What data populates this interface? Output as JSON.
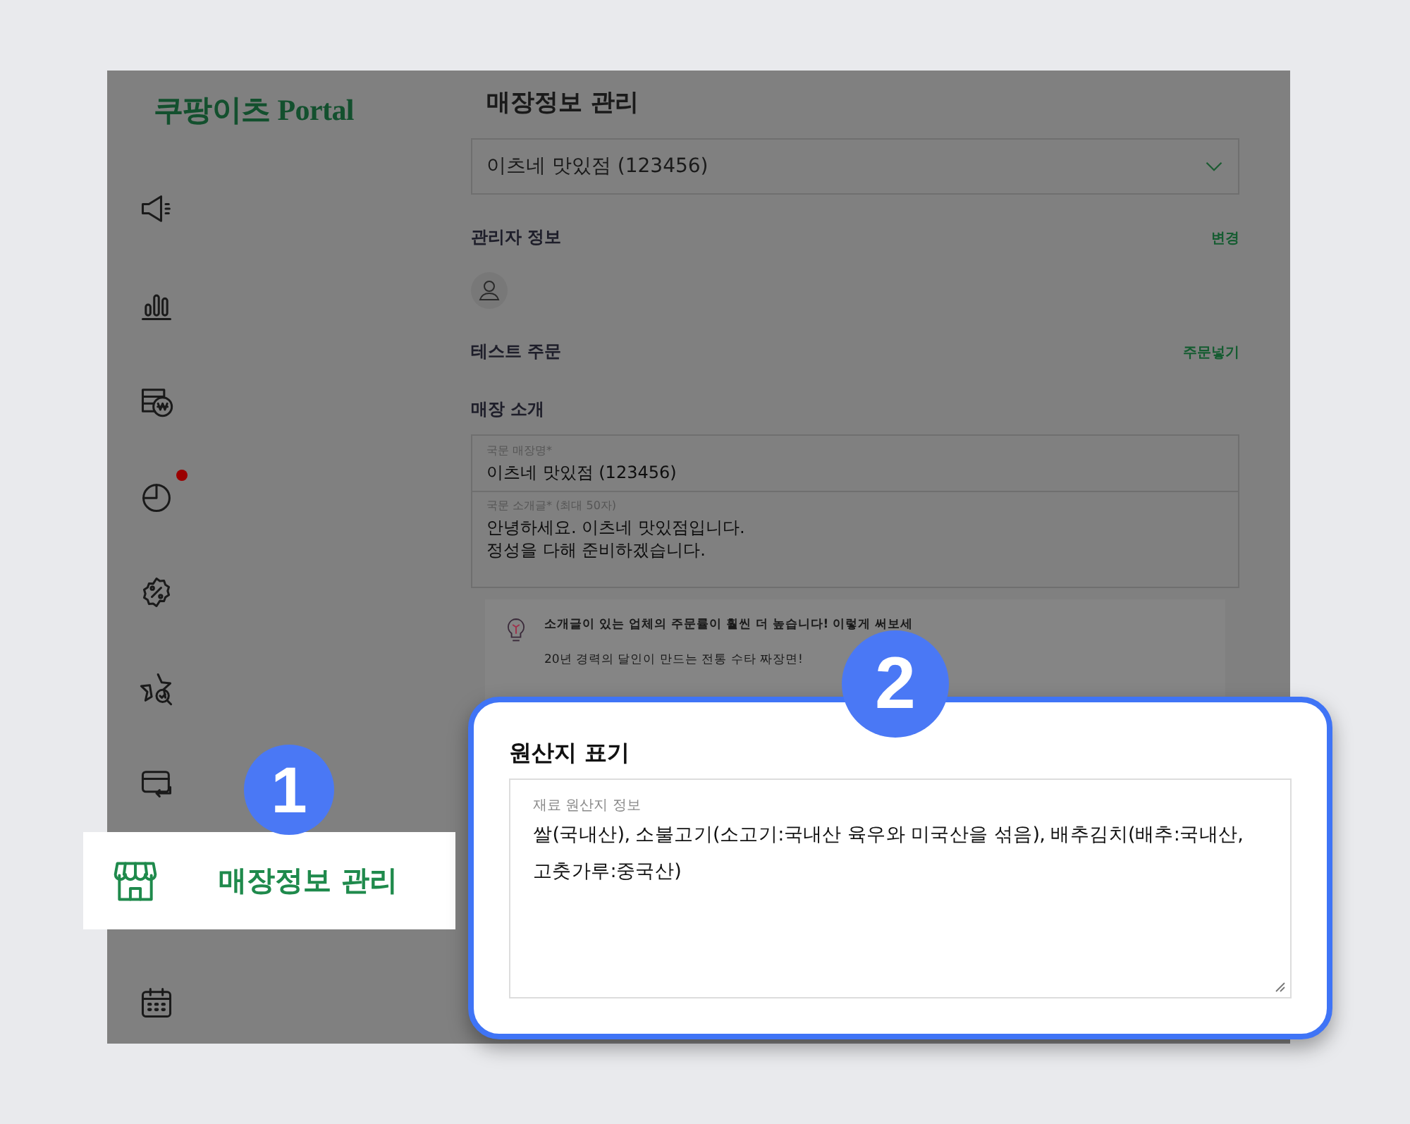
{
  "logo": "쿠팡이츠 Portal",
  "sidebar": {
    "items": [
      {
        "kind": "megaphone",
        "notification": false,
        "highlighted": false
      },
      {
        "kind": "bars",
        "notification": false,
        "highlighted": false
      },
      {
        "kind": "coins",
        "notification": false,
        "highlighted": false
      },
      {
        "kind": "pie",
        "notification": true,
        "highlighted": false
      },
      {
        "kind": "discount",
        "notification": false,
        "highlighted": false
      },
      {
        "kind": "star",
        "notification": false,
        "highlighted": false
      },
      {
        "kind": "card",
        "notification": false,
        "highlighted": false
      },
      {
        "kind": "store",
        "notification": false,
        "highlighted": true,
        "label": "매장정보 관리"
      },
      {
        "kind": "calendar",
        "notification": false,
        "highlighted": false
      }
    ]
  },
  "page": {
    "title": "매장정보 관리",
    "store_select": {
      "value": "이츠네 맛있점 (123456)"
    },
    "sections": [
      {
        "kind": "manager",
        "title": "관리자 정보",
        "action": "변경"
      },
      {
        "kind": "plain",
        "title": "테스트 주문",
        "action": "주문넣기"
      }
    ],
    "intro": {
      "title": "매장 소개",
      "name_field": {
        "label": "국문 매장명*",
        "value": "이츠네 맛있점 (123456)"
      },
      "desc_field": {
        "label": "국문 소개글*",
        "hint": "(최대 50자)",
        "value": "안녕하세요. 이츠네 맛있점입니다.\n정성을 다해 준비하겠습니다."
      },
      "tip": {
        "lines": [
          "소개글이 있는 업체의 주문률이 훨씬 더 높습니다! 이렇게 써보세",
          "20년 경력의 달인이 만드는 전통 수타 짜장면!"
        ]
      }
    }
  },
  "callouts": [
    {
      "number": "1"
    },
    {
      "number": "2"
    }
  ],
  "origin_card": {
    "title": "원산지 표기",
    "field": {
      "label": "재료 원산지 정보",
      "value": "쌀(국내산), 소불고기(소고기:국내산 육우와 미국산을 섞음), 배추김치(배추:국내산, 고춧가루:중국산)"
    }
  }
}
